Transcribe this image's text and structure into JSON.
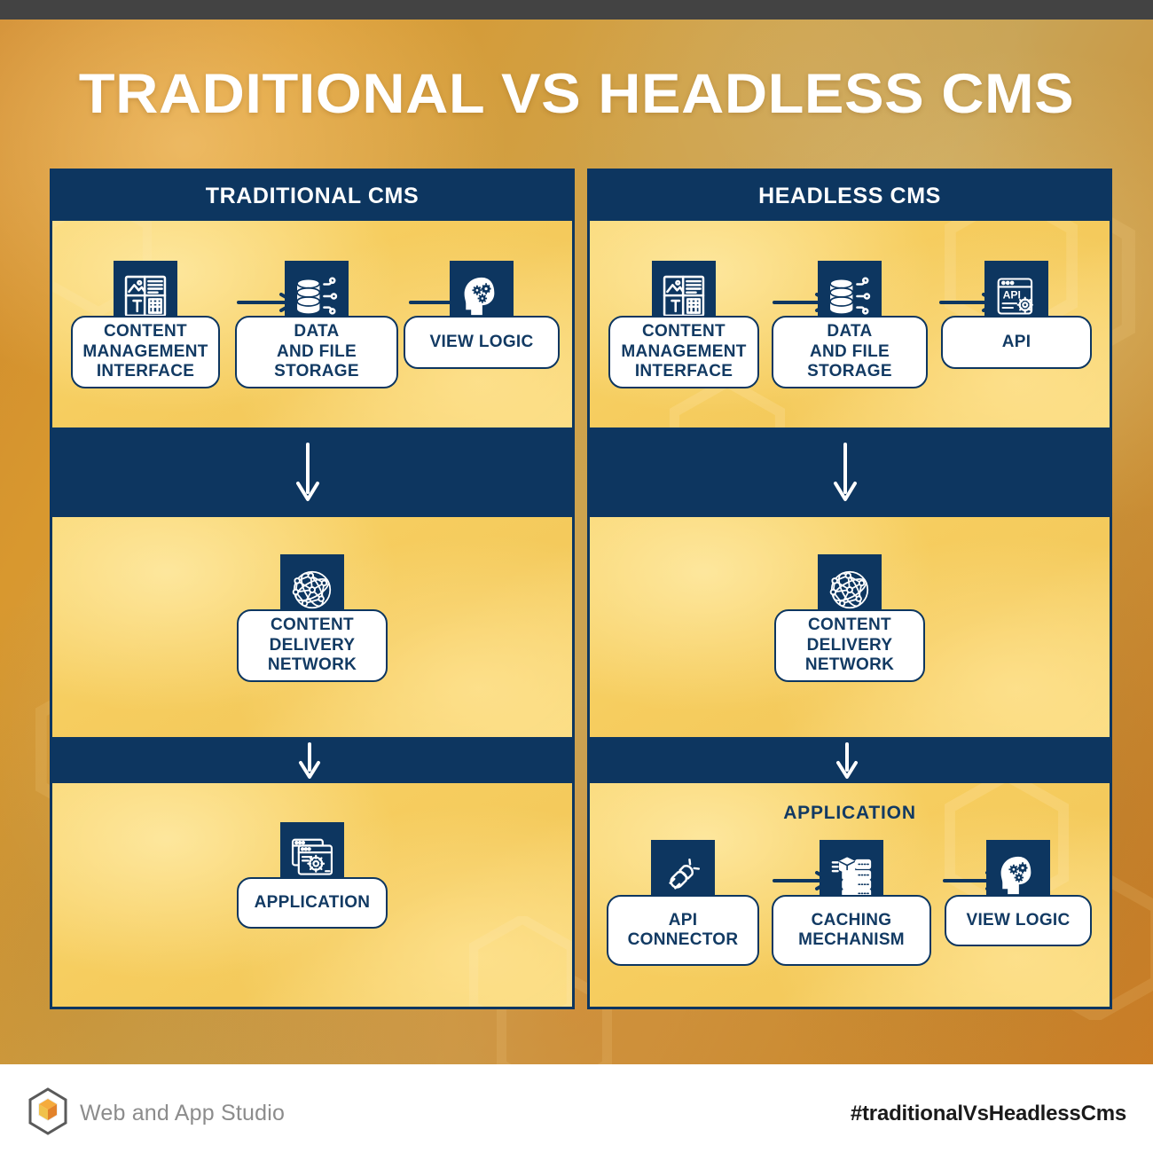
{
  "title": "TRADITIONAL VS HEADLESS CMS",
  "colors": {
    "navy": "#0d3660",
    "label_text": "#123a63",
    "yellow": "#f6cd5f",
    "orange_bg": "#cf8a2e",
    "white": "#ffffff",
    "topbar": "#434343",
    "brand_gray": "#8c8c8c",
    "logo_orange": "#ef8a2a"
  },
  "panels": [
    {
      "key": "traditional",
      "header": "TRADITIONAL CMS",
      "row1": {
        "nodes": [
          {
            "label": "CONTENT\nMANAGEMENT\nINTERFACE",
            "icon": "content-management-icon"
          },
          {
            "label": "DATA\nAND FILE\nSTORAGE",
            "icon": "database-icon"
          },
          {
            "label": "VIEW LOGIC",
            "icon": "head-gears-icon"
          }
        ],
        "arrows": [
          "arrow-right-icon",
          "arrow-right-icon"
        ]
      },
      "connector1": "arrow-down-icon",
      "row2": {
        "nodes": [
          {
            "label": "CONTENT\nDELIVERY\nNETWORK",
            "icon": "globe-network-icon"
          }
        ]
      },
      "connector2": "arrow-down-icon",
      "row3": {
        "heading": "",
        "nodes": [
          {
            "label": "APPLICATION",
            "icon": "app-windows-gear-icon"
          }
        ]
      }
    },
    {
      "key": "headless",
      "header": "HEADLESS CMS",
      "row1": {
        "nodes": [
          {
            "label": "CONTENT\nMANAGEMENT\nINTERFACE",
            "icon": "content-management-icon"
          },
          {
            "label": "DATA\nAND FILE\nSTORAGE",
            "icon": "database-icon"
          },
          {
            "label": "API",
            "icon": "api-window-gear-icon"
          }
        ],
        "arrows": [
          "arrow-right-icon",
          "arrow-right-icon"
        ]
      },
      "connector1": "arrow-down-icon",
      "row2": {
        "nodes": [
          {
            "label": "CONTENT\nDELIVERY\nNETWORK",
            "icon": "globe-network-icon"
          }
        ]
      },
      "connector2": "arrow-down-icon",
      "row3": {
        "heading": "APPLICATION",
        "nodes": [
          {
            "label": "API\nCONNECTOR",
            "icon": "plug-connector-icon"
          },
          {
            "label": "CACHING\nMECHANISM",
            "icon": "server-cache-icon"
          },
          {
            "label": "VIEW LOGIC",
            "icon": "head-gears-icon"
          }
        ],
        "arrows": [
          "arrow-right-icon",
          "arrow-right-icon"
        ]
      }
    }
  ],
  "footer": {
    "brand_name": "Web and App Studio",
    "logo": "hexagon-cube-logo",
    "hashtag": "#traditionalVsHeadlessCms"
  }
}
